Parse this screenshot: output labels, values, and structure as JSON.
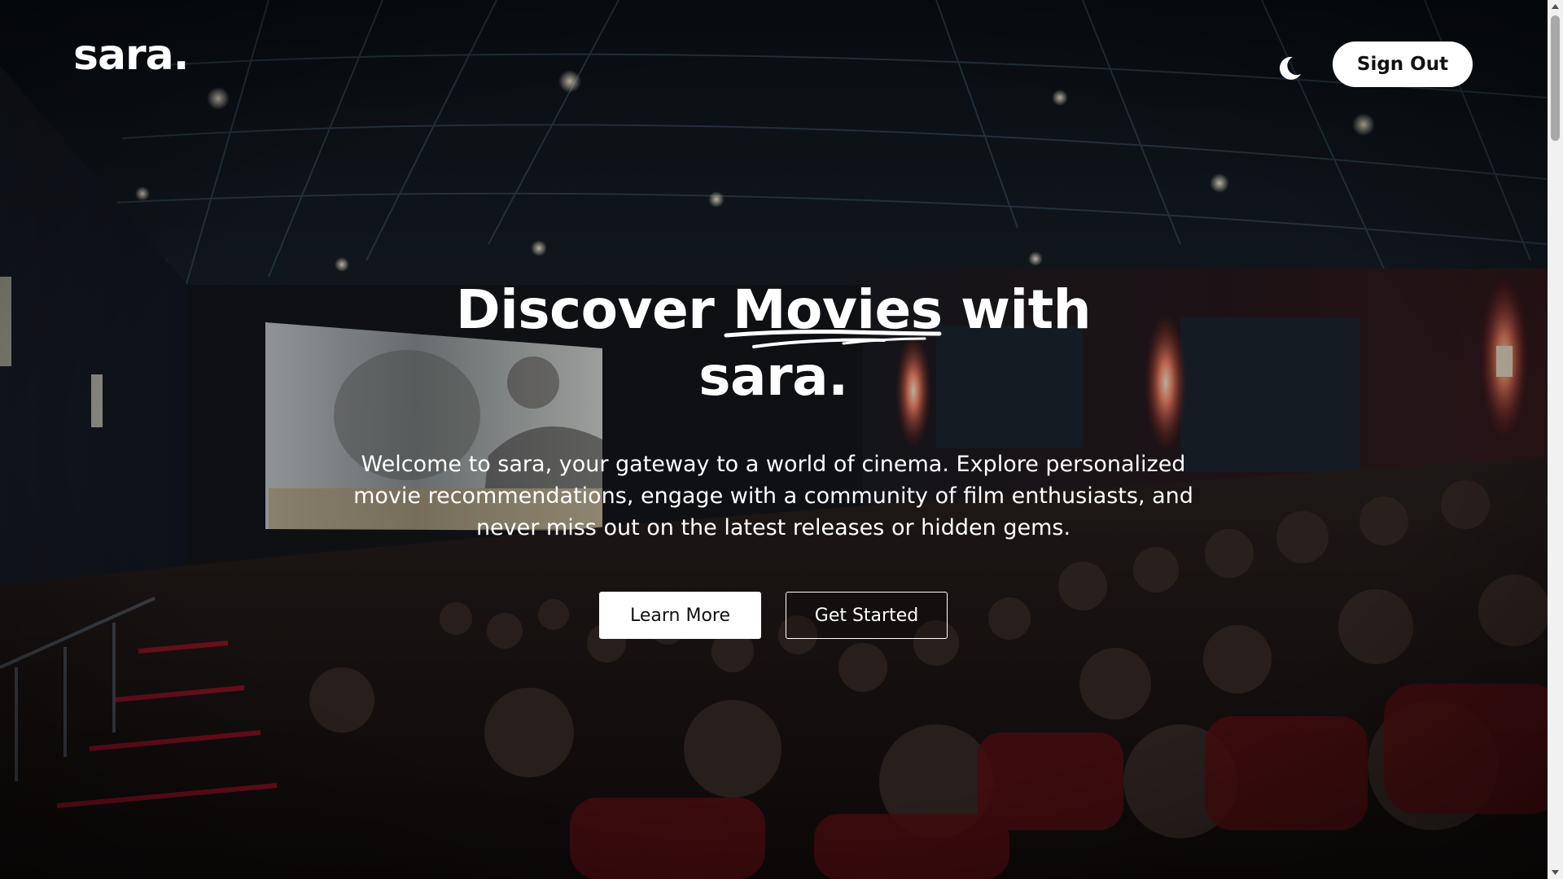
{
  "header": {
    "logo": "sara.",
    "theme_toggle_icon": "moon-icon",
    "sign_out_label": "Sign Out"
  },
  "hero": {
    "title_before": "Discover ",
    "title_highlight": "Movies",
    "title_after": " with",
    "title_line2": "sara.",
    "description": "Welcome to sara, your gateway to a world of cinema. Explore personalized movie recommendations, engage with a community of film enthusiasts, and never miss out on the latest releases or hidden gems.",
    "learn_more_label": "Learn More",
    "get_started_label": "Get Started"
  },
  "background": {
    "image": "cinema-theater-photo"
  },
  "colors": {
    "text": "#ffffff",
    "button_bg": "#ffffff",
    "button_text": "#111111",
    "overlay": "#000000",
    "seat_red": "#7a1216"
  }
}
